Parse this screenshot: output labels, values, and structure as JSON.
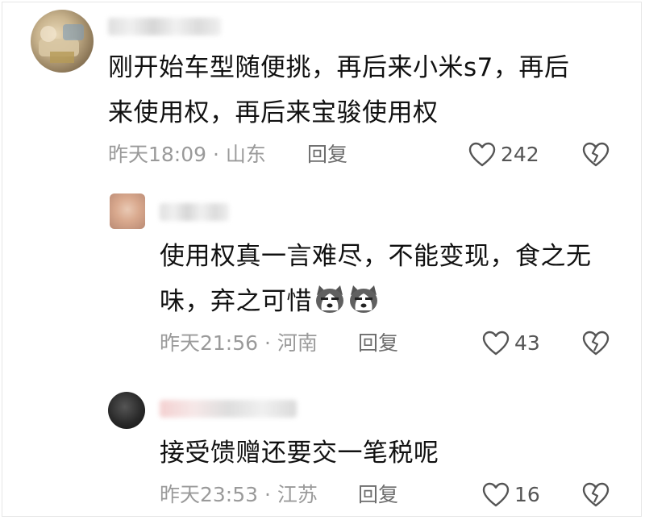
{
  "comments": [
    {
      "text_line1": "刚开始车型随便挑，再后来小米s7，再后",
      "text_line2": "来使用权，再后来宝骏使用权",
      "time": "昨天18:09",
      "location": "山东",
      "reply_label": "回复",
      "likes": "242"
    },
    {
      "text_line1": "使用权真一言难尽，不能变现，食之无",
      "text_line2": "味，弃之可惜",
      "time": "昨天21:56",
      "location": "河南",
      "reply_label": "回复",
      "likes": "43"
    },
    {
      "text_line1": "接受馈赠还要交一笔税呢",
      "time": "昨天23:53",
      "location": "江苏",
      "reply_label": "回复",
      "likes": "16"
    }
  ],
  "separator": " · ",
  "icons": {
    "like": "heart-outline-icon",
    "dislike": "broken-heart-icon",
    "emoji": "husky-dog-emoji"
  },
  "colors": {
    "text": "#111111",
    "meta": "#9a9a9a",
    "icon": "#555555"
  }
}
